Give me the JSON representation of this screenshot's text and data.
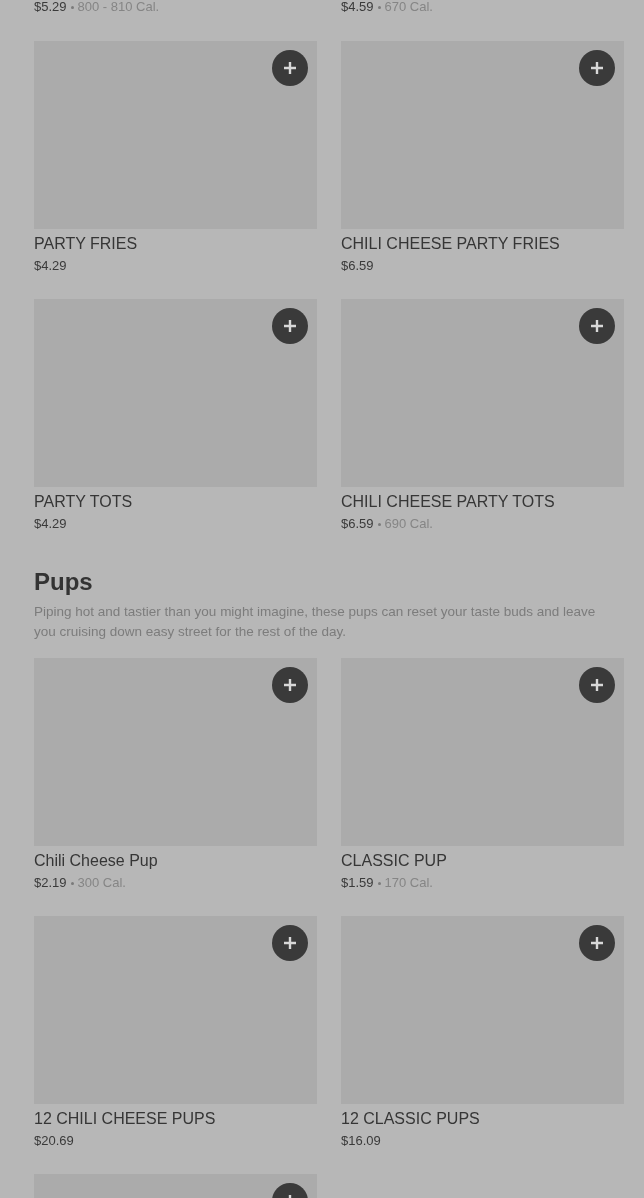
{
  "cut_items": [
    {
      "price": "$5.29",
      "calories": "800 - 810 Cal."
    },
    {
      "price": "$4.59",
      "calories": "670 Cal."
    }
  ],
  "items": [
    {
      "kind": "item",
      "name": "PARTY FRIES",
      "price": "$4.29"
    },
    {
      "kind": "item",
      "name": "CHILI CHEESE PARTY FRIES",
      "price": "$6.59"
    },
    {
      "kind": "item",
      "name": "PARTY TOTS",
      "price": "$4.29"
    },
    {
      "kind": "item",
      "name": "CHILI CHEESE PARTY TOTS",
      "price": "$6.59",
      "calories": "690 Cal."
    }
  ],
  "sections": [
    {
      "title": "Pups",
      "description": "Piping hot and tastier than you might imagine, these pups can reset your taste buds and leave you cruising down easy street for the rest of the day.",
      "items": [
        {
          "kind": "item",
          "name": "Chili Cheese Pup",
          "price": "$2.19",
          "calories": "300 Cal."
        },
        {
          "kind": "item",
          "name": "CLASSIC PUP",
          "price": "$1.59",
          "calories": "170 Cal."
        },
        {
          "kind": "item",
          "name": "12 CHILI CHEESE PUPS",
          "price": "$20.69"
        },
        {
          "kind": "item",
          "name": "12 CLASSIC PUPS",
          "price": "$16.09"
        },
        {
          "kind": "picture_only"
        }
      ]
    }
  ]
}
